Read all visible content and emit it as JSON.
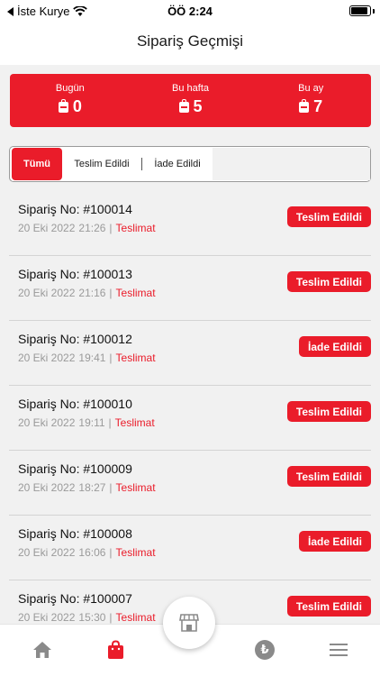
{
  "status_bar": {
    "back_label": "İste Kurye",
    "time": "ÖÖ 2:24",
    "battery_level": 0.9
  },
  "nav": {
    "title": "Sipariş Geçmişi"
  },
  "summary": [
    {
      "label": "Bugün",
      "value": "0"
    },
    {
      "label": "Bu hafta",
      "value": "5"
    },
    {
      "label": "Bu ay",
      "value": "7"
    }
  ],
  "filter": {
    "all": "Tümü",
    "delivered": "Teslim Edildi",
    "returned": "İade Edildi"
  },
  "orders": [
    {
      "title": "Sipariş No: #100014",
      "date": "20 Eki 2022",
      "time": "21:26",
      "kind": "Teslimat",
      "status": "Teslim Edildi"
    },
    {
      "title": "Sipariş No: #100013",
      "date": "20 Eki 2022",
      "time": "21:16",
      "kind": "Teslimat",
      "status": "Teslim Edildi"
    },
    {
      "title": "Sipariş No: #100012",
      "date": "20 Eki 2022",
      "time": "19:41",
      "kind": "Teslimat",
      "status": "İade Edildi"
    },
    {
      "title": "Sipariş No: #100010",
      "date": "20 Eki 2022",
      "time": "19:11",
      "kind": "Teslimat",
      "status": "Teslim Edildi"
    },
    {
      "title": "Sipariş No: #100009",
      "date": "20 Eki 2022",
      "time": "18:27",
      "kind": "Teslimat",
      "status": "Teslim Edildi"
    },
    {
      "title": "Sipariş No: #100008",
      "date": "20 Eki 2022",
      "time": "16:06",
      "kind": "Teslimat",
      "status": "İade Edildi"
    },
    {
      "title": "Sipariş No: #100007",
      "date": "20 Eki 2022",
      "time": "15:30",
      "kind": "Teslimat",
      "status": "Teslim Edildi"
    }
  ],
  "tabbar": {
    "lira_symbol": "₺"
  },
  "colors": {
    "accent": "#ea1c2a",
    "muted": "#9a9a9a",
    "inactive_icon": "#8a8a8a"
  },
  "icons": [
    "back-arrow-icon",
    "wifi-icon",
    "battery-icon",
    "bag-icon",
    "home-icon",
    "shopping-bag-icon",
    "store-icon",
    "lira-icon",
    "menu-icon"
  ]
}
